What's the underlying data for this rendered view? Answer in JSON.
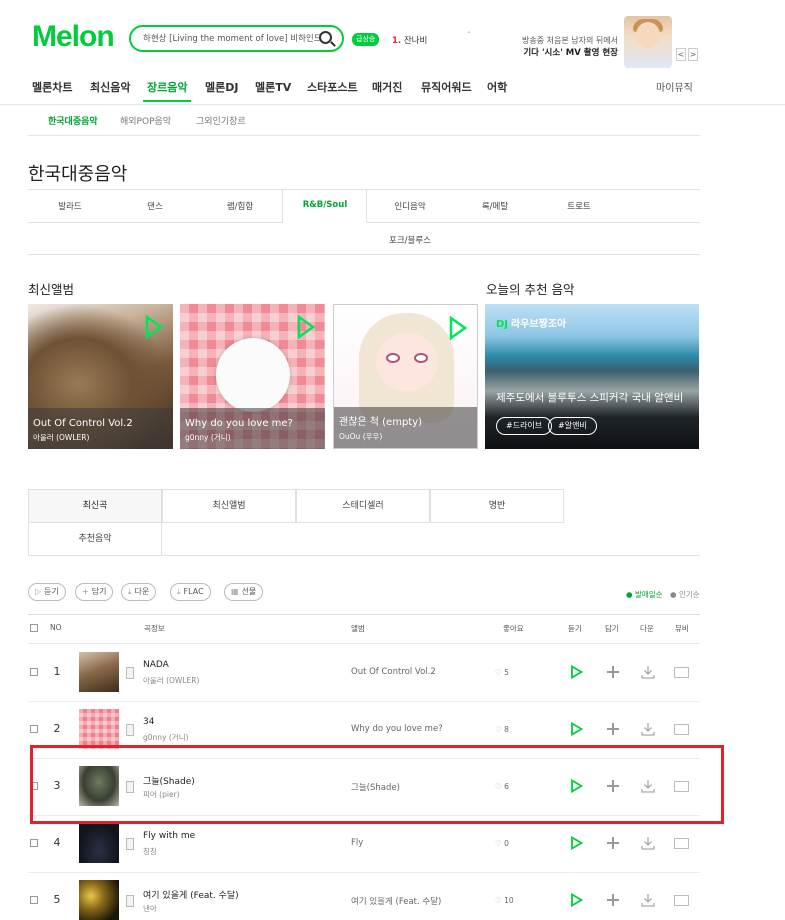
{
  "header": {
    "logo": "Melon",
    "search_placeholder": "하현상 [Living the moment of love] 비하인드",
    "realtime_badge": "급상승",
    "realtime_rank": "1.",
    "realtime_keyword": "잔나비",
    "promo_line1": "방송중 처음본 남자의 뒤에서",
    "promo_line2": "기다 '시소' MV 촬영 현장",
    "prev": "<",
    "next": ">"
  },
  "gnb": [
    "멜론차트",
    "최신음악",
    "장르음악",
    "멜론DJ",
    "멜론TV",
    "스타포스트",
    "매거진",
    "뮤직어워드",
    "어학"
  ],
  "gnb_mymusic": "마이뮤직",
  "subnav": [
    "한국대중음악",
    "해외POP음악",
    "그외인기장르"
  ],
  "page_title": "한국대중음악",
  "genres": [
    "발라드",
    "댄스",
    "랩/힙합",
    "R&B/Soul",
    "인디음악",
    "록/메탈",
    "트로트",
    "포크/블루스"
  ],
  "new_albums_title": "최신앨범",
  "new_albums": [
    {
      "title": "Out Of Control Vol.2",
      "artist": "아울러 (OWLER)"
    },
    {
      "title": "Why do you love me?",
      "artist": "g0nny (거니)"
    },
    {
      "title": "괜찮은 척 (empty)",
      "artist": "OuOu (우우)"
    }
  ],
  "reco_title": "오늘의 추천 음악",
  "reco": {
    "dj_label": "DJ",
    "dj_name": "라우브짱조아",
    "title": "제주도에서 블루투스 스피커각 국내 알앤비",
    "tags": [
      "#드라이브",
      "#알앤비"
    ]
  },
  "tabs": [
    "최신곡",
    "최신앨범",
    "스테디셀러",
    "명반",
    "추천음악"
  ],
  "actions": [
    "듣기",
    "담기",
    "다운",
    "FLAC",
    "선물"
  ],
  "sort": {
    "on": "발매일순",
    "off": "인기순"
  },
  "table_headers": {
    "no": "NO",
    "song": "곡정보",
    "album": "앨범",
    "like": "좋아요",
    "listen": "듣기",
    "add": "담기",
    "down": "다운",
    "mv": "뮤비"
  },
  "songs": [
    {
      "rank": "1",
      "title": "NADA",
      "artist": "아울러 (OWLER)",
      "album": "Out Of Control Vol.2",
      "likes": "5"
    },
    {
      "rank": "2",
      "title": "34",
      "artist": "g0nny (거니)",
      "album": "Why do you love me?",
      "likes": "8"
    },
    {
      "rank": "3",
      "title": "그늘(Shade)",
      "artist": "피어 (pier)",
      "album": "그늘(Shade)",
      "likes": "6"
    },
    {
      "rank": "4",
      "title": "Fly with me",
      "artist": "칭칭",
      "album": "Fly",
      "likes": "0"
    },
    {
      "rank": "5",
      "title": "여기 있을게 (Feat. 수달)",
      "artist": "낸아",
      "album": "여기 있을게 (Feat. 수달)",
      "likes": "10"
    }
  ],
  "colors": {
    "brand": "#00cd3c",
    "highlight": "#e1222a"
  }
}
